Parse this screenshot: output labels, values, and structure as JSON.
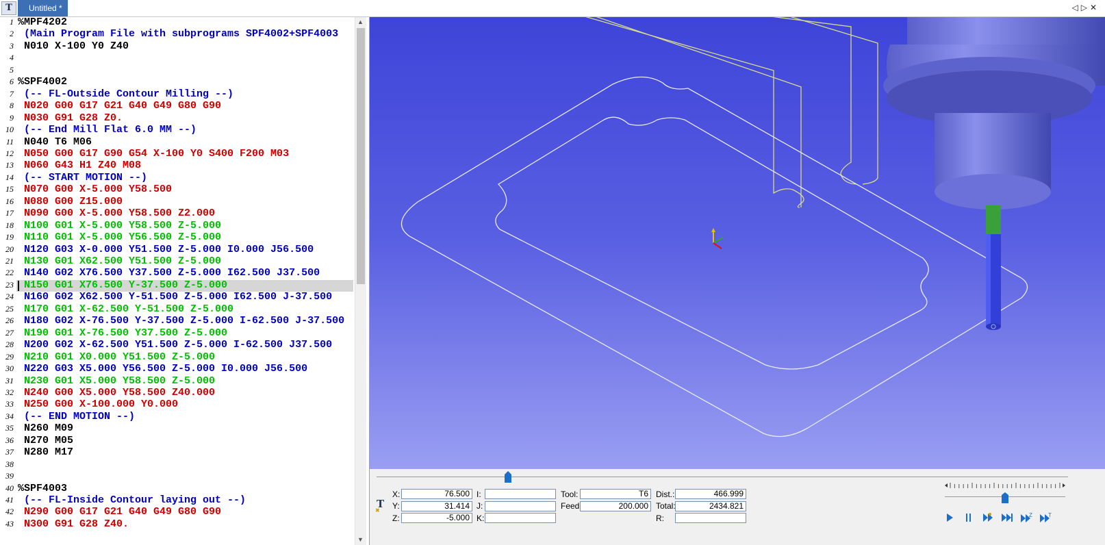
{
  "tabs": [
    {
      "label": "Untitled *",
      "active": true
    }
  ],
  "tab_nav": {
    "prev": "◁",
    "next": "▷",
    "close": "✕"
  },
  "colors": {
    "tab_active": "#3c6fb3",
    "code_black": "#000000",
    "code_comment": "#0000c0",
    "code_red": "#d00000",
    "code_green": "#00c000",
    "code_blue": "#0000c0",
    "viewport_top": "#3e44d8",
    "viewport_bottom": "#9a9ef2",
    "toolpath": "#e8ecff",
    "toolpath_approach": "#d8dc8c",
    "tool_body": "#7078e0",
    "tool_shank": "#3aa03a",
    "tool_flute": "#3040d8"
  },
  "editor": {
    "current_line": 23,
    "lines": [
      {
        "n": "1",
        "text": "%MPF4202",
        "color": "black"
      },
      {
        "n": "2",
        "text": " (Main Program File with subprograms SPF4002+SPF4003",
        "color": "comment"
      },
      {
        "n": "3",
        "text": " N010 X-100 Y0 Z40",
        "color": "black"
      },
      {
        "n": "4",
        "text": "",
        "color": "black"
      },
      {
        "n": "5",
        "text": "",
        "color": "black"
      },
      {
        "n": "6",
        "text": "%SPF4002",
        "color": "black"
      },
      {
        "n": "7",
        "text": " (-- FL-Outside Contour Milling --)",
        "color": "comment"
      },
      {
        "n": "8",
        "text": " N020 G00 G17 G21 G40 G49 G80 G90",
        "color": "red"
      },
      {
        "n": "9",
        "text": " N030 G91 G28 Z0.",
        "color": "red"
      },
      {
        "n": "10",
        "text": " (-- End Mill Flat 6.0 MM --)",
        "color": "comment"
      },
      {
        "n": "11",
        "text": " N040 T6 M06",
        "color": "black"
      },
      {
        "n": "12",
        "text": " N050 G00 G17 G90 G54 X-100 Y0 S400 F200 M03",
        "color": "red"
      },
      {
        "n": "13",
        "text": " N060 G43 H1 Z40 M08",
        "color": "red"
      },
      {
        "n": "14",
        "text": " (-- START MOTION --)",
        "color": "comment"
      },
      {
        "n": "15",
        "text": " N070 G00 X-5.000 Y58.500",
        "color": "red"
      },
      {
        "n": "16",
        "text": " N080 G00 Z15.000",
        "color": "red"
      },
      {
        "n": "17",
        "text": " N090 G00 X-5.000 Y58.500 Z2.000",
        "color": "red"
      },
      {
        "n": "18",
        "text": " N100 G01 X-5.000 Y58.500 Z-5.000",
        "color": "green"
      },
      {
        "n": "19",
        "text": " N110 G01 X-5.000 Y56.500 Z-5.000",
        "color": "green"
      },
      {
        "n": "20",
        "text": " N120 G03 X-0.000 Y51.500 Z-5.000 I0.000 J56.500",
        "color": "blue"
      },
      {
        "n": "21",
        "text": " N130 G01 X62.500 Y51.500 Z-5.000",
        "color": "green"
      },
      {
        "n": "22",
        "text": " N140 G02 X76.500 Y37.500 Z-5.000 I62.500 J37.500",
        "color": "blue"
      },
      {
        "n": "23",
        "text": " N150 G01 X76.500 Y-37.500 Z-5.000",
        "color": "green"
      },
      {
        "n": "24",
        "text": " N160 G02 X62.500 Y-51.500 Z-5.000 I62.500 J-37.500",
        "color": "blue"
      },
      {
        "n": "25",
        "text": " N170 G01 X-62.500 Y-51.500 Z-5.000",
        "color": "green"
      },
      {
        "n": "26",
        "text": " N180 G02 X-76.500 Y-37.500 Z-5.000 I-62.500 J-37.500",
        "color": "blue"
      },
      {
        "n": "27",
        "text": " N190 G01 X-76.500 Y37.500 Z-5.000",
        "color": "green"
      },
      {
        "n": "28",
        "text": " N200 G02 X-62.500 Y51.500 Z-5.000 I-62.500 J37.500",
        "color": "blue"
      },
      {
        "n": "29",
        "text": " N210 G01 X0.000 Y51.500 Z-5.000",
        "color": "green"
      },
      {
        "n": "30",
        "text": " N220 G03 X5.000 Y56.500 Z-5.000 I0.000 J56.500",
        "color": "blue"
      },
      {
        "n": "31",
        "text": " N230 G01 X5.000 Y58.500 Z-5.000",
        "color": "green"
      },
      {
        "n": "32",
        "text": " N240 G00 X5.000 Y58.500 Z40.000",
        "color": "red"
      },
      {
        "n": "33",
        "text": " N250 G00 X-100.000 Y0.000",
        "color": "red"
      },
      {
        "n": "34",
        "text": " (-- END MOTION --)",
        "color": "comment"
      },
      {
        "n": "35",
        "text": " N260 M09",
        "color": "black"
      },
      {
        "n": "36",
        "text": " N270 M05",
        "color": "black"
      },
      {
        "n": "37",
        "text": " N280 M17",
        "color": "black"
      },
      {
        "n": "38",
        "text": "",
        "color": "black"
      },
      {
        "n": "39",
        "text": "",
        "color": "black"
      },
      {
        "n": "40",
        "text": "%SPF4003",
        "color": "black"
      },
      {
        "n": "41",
        "text": " (-- FL-Inside Contour laying out --)",
        "color": "comment"
      },
      {
        "n": "42",
        "text": " N290 G00 G17 G21 G40 G49 G80 G90",
        "color": "red"
      },
      {
        "n": "43",
        "text": " N300 G91 G28 Z40.",
        "color": "red"
      }
    ]
  },
  "panel": {
    "x_label": "X:",
    "x_value": "76.500",
    "y_label": "Y:",
    "y_value": "31.414",
    "z_label": "Z:",
    "z_value": "-5.000",
    "i_label": "I:",
    "i_value": "",
    "j_label": "J:",
    "j_value": "",
    "k_label": "K:",
    "k_value": "",
    "tool_label": "Tool:",
    "tool_value": "T6",
    "feed_label": "Feed:",
    "feed_value": "200.000",
    "dist_label": "Dist.:",
    "dist_value": "466.999",
    "total_label": "Total:",
    "total_value": "2434.821",
    "r_label": "R:",
    "r_value": "",
    "playback_progress": 0.19,
    "speed_level": 0.5
  },
  "playback_controls": [
    "play-icon",
    "pause-icon",
    "step-forward-icon",
    "fast-forward-icon",
    "step-z-icon",
    "step-tool-icon"
  ]
}
